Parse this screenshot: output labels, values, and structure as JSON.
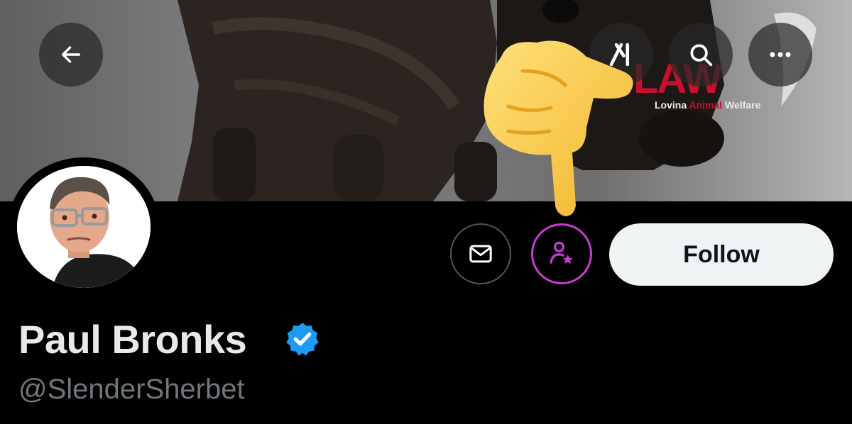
{
  "banner": {
    "brand_logo_text": "LAW",
    "brand_tagline_part1": "Lovina ",
    "brand_tagline_accent": "Animal",
    "brand_tagline_part2": " Welfare"
  },
  "header": {
    "back_icon": "arrow-left-icon",
    "grok_icon": "grok-icon",
    "search_icon": "search-icon",
    "more_icon": "more-horizontal-icon"
  },
  "profile": {
    "display_name": "Paul Bronks",
    "verified": true,
    "handle": "@SlenderSherbet",
    "avatar": "memoji-avatar"
  },
  "actions": {
    "message_icon": "envelope-icon",
    "subscribe_icon": "person-star-icon",
    "follow_label": "Follow"
  },
  "overlay": {
    "emoji": "pointing-hand-emoji"
  },
  "colors": {
    "background": "#000000",
    "name_text": "#e7e9ea",
    "handle_text": "#71767b",
    "follow_bg": "#eff3f4",
    "subscribe_accent": "#c93bd1",
    "verified_blue": "#1d9bf0",
    "brand_red": "#c8102e"
  }
}
